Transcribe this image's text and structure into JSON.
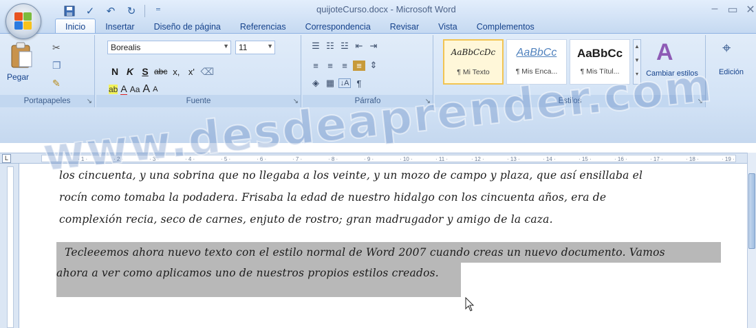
{
  "window": {
    "title": "quijoteCurso.docx - Microsoft Word"
  },
  "tabs": [
    {
      "label": "Inicio",
      "active": true
    },
    {
      "label": "Insertar"
    },
    {
      "label": "Diseño de página"
    },
    {
      "label": "Referencias"
    },
    {
      "label": "Correspondencia"
    },
    {
      "label": "Revisar"
    },
    {
      "label": "Vista"
    },
    {
      "label": "Complementos"
    }
  ],
  "clipboard": {
    "paste_label": "Pegar",
    "group_label": "Portapapeles"
  },
  "font": {
    "family": "Borealis",
    "size": "11",
    "group_label": "Fuente",
    "bold": "N",
    "italic": "K",
    "underline": "S",
    "strike": "abc",
    "subscript": "x,",
    "superscript": "x'",
    "change_case": "Aa",
    "grow": "A",
    "shrink": "A"
  },
  "paragraph": {
    "group_label": "Párrafo",
    "sort": "↓A",
    "pilcrow": "¶"
  },
  "styles": {
    "group_label": "Estilos",
    "items": [
      {
        "sample": "AaBbCcDc",
        "name": "¶ Mi Texto"
      },
      {
        "sample": "AaBbCc",
        "name": "¶ Mis Enca..."
      },
      {
        "sample": "AaBbCc",
        "name": "¶ Mis Títul..."
      }
    ],
    "change_styles_label": "Cambiar estilos"
  },
  "editing": {
    "label": "Edición"
  },
  "doc": {
    "lines": [
      "los cincuenta, y una sobrina que no llegaba a los veinte, y un mozo de campo y plaza, que así ensillaba el",
      "rocín como tomaba la podadera. Frisaba la edad de nuestro hidalgo con los cincuenta años, era de",
      "complexión recia, seco de carnes, enjuto de rostro; gran madrugador y amigo de la caza."
    ],
    "selected_lines": [
      "Tecleeemos ahora nuevo texto con el estilo normal de Word 2007 cuando creas un nuevo documento. Vamos",
      "ahora a ver como aplicamos uno de nuestros propios estilos creados."
    ]
  },
  "watermark": "www.desdeaprender.com",
  "colors": {
    "ribbon": "#d3e3f6",
    "tab_text": "#15428b",
    "selection": "#b8b8b8"
  }
}
